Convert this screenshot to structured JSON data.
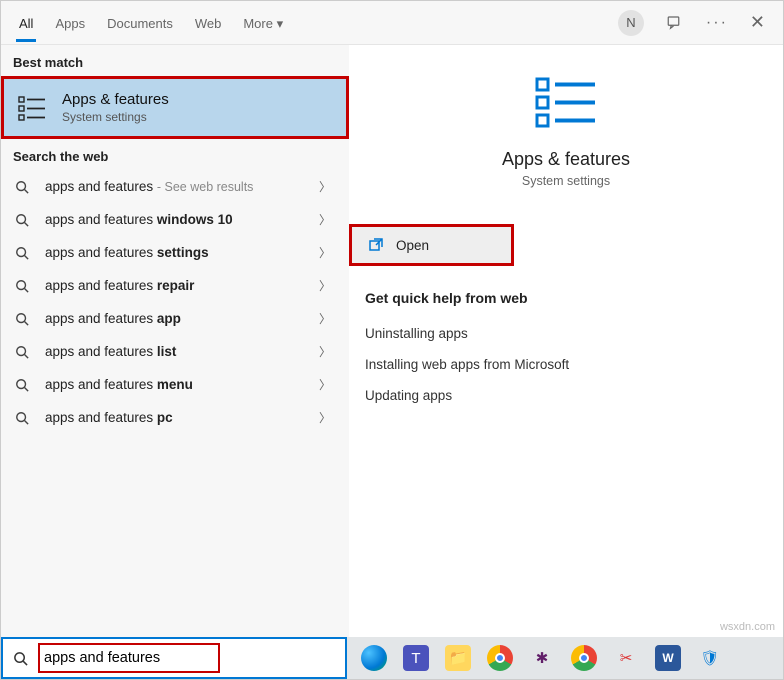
{
  "topbar": {
    "tabs": {
      "all": "All",
      "apps": "Apps",
      "documents": "Documents",
      "web": "Web",
      "more": "More"
    },
    "avatar": "N"
  },
  "left": {
    "best_match_label": "Best match",
    "best_match": {
      "title": "Apps & features",
      "sub": "System settings"
    },
    "search_web_label": "Search the web",
    "web_items": [
      {
        "prefix": "apps and features",
        "suffix": "",
        "trail": "- See web results"
      },
      {
        "prefix": "apps and features ",
        "suffix": "windows 10",
        "trail": ""
      },
      {
        "prefix": "apps and features ",
        "suffix": "settings",
        "trail": ""
      },
      {
        "prefix": "apps and features ",
        "suffix": "repair",
        "trail": ""
      },
      {
        "prefix": "apps and features ",
        "suffix": "app",
        "trail": ""
      },
      {
        "prefix": "apps and features ",
        "suffix": "list",
        "trail": ""
      },
      {
        "prefix": "apps and features ",
        "suffix": "menu",
        "trail": ""
      },
      {
        "prefix": "apps and features ",
        "suffix": "pc",
        "trail": ""
      }
    ]
  },
  "right": {
    "title": "Apps & features",
    "sub": "System settings",
    "open": "Open",
    "help_label": "Get quick help from web",
    "help_links": [
      "Uninstalling apps",
      "Installing web apps from Microsoft",
      "Updating apps"
    ]
  },
  "search": {
    "value": "apps and features"
  },
  "watermark": "wsxdn.com"
}
